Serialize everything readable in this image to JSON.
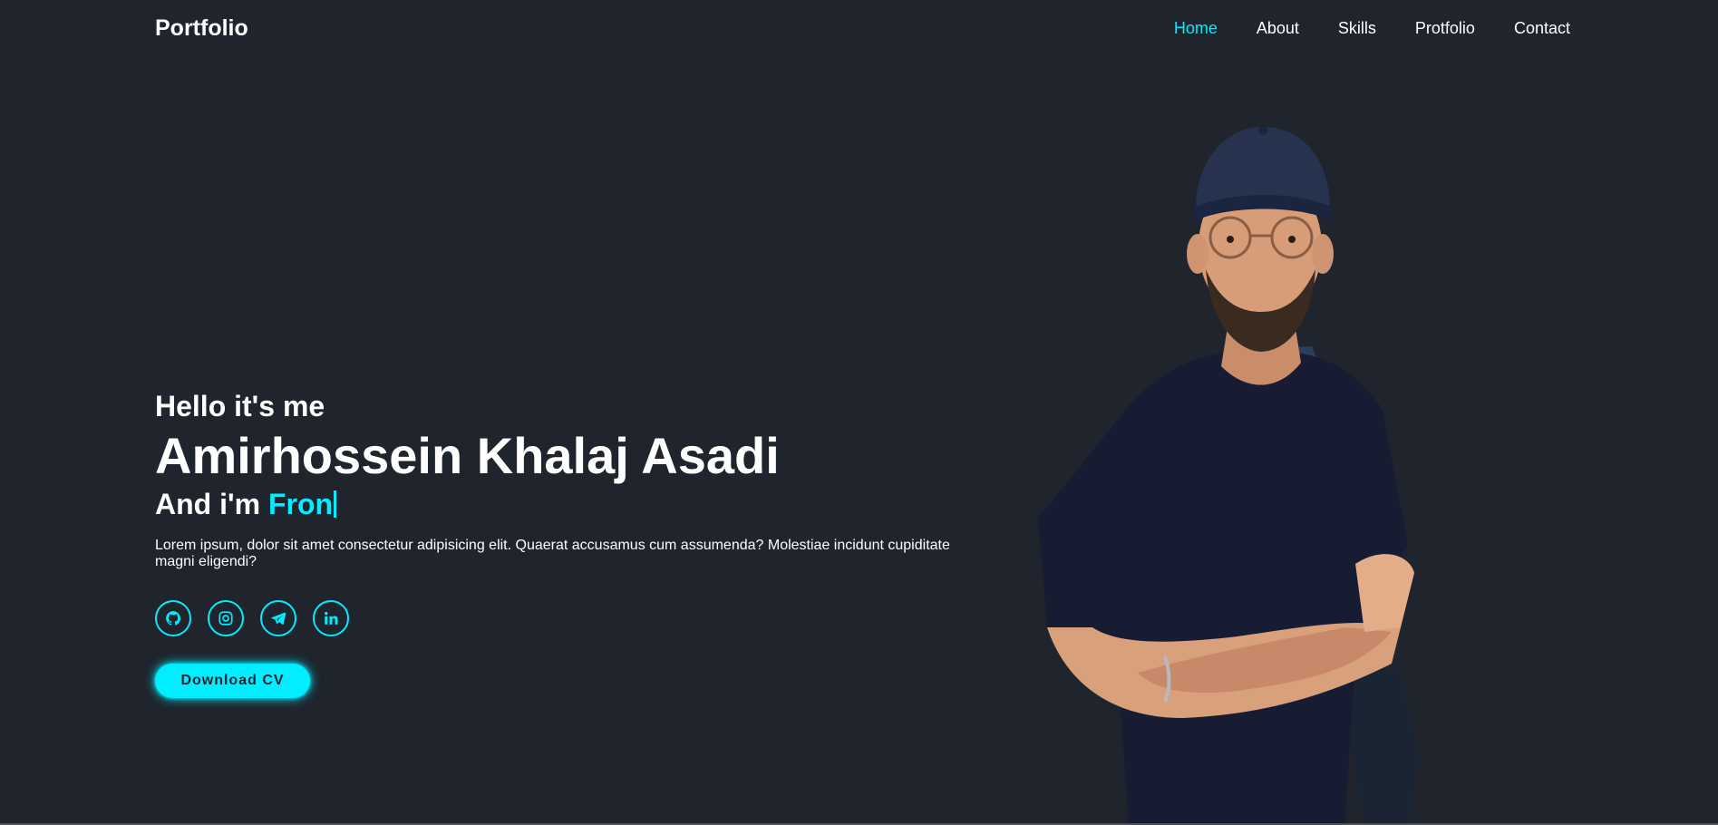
{
  "header": {
    "logo": "Portfolio",
    "nav": [
      {
        "label": "Home",
        "active": true
      },
      {
        "label": "About",
        "active": false
      },
      {
        "label": "Skills",
        "active": false
      },
      {
        "label": "Protfolio",
        "active": false
      },
      {
        "label": "Contact",
        "active": false
      }
    ]
  },
  "hero": {
    "greeting": "Hello it's me",
    "name": "Amirhossein Khalaj Asadi",
    "role_prefix": "And i'm",
    "role_typed": "Fron",
    "description": "Lorem ipsum, dolor sit amet consectetur adipisicing elit. Quaerat accusamus cum assumenda? Molestiae incidunt cupiditate magni eligendi?",
    "socials": [
      "github-icon",
      "instagram-icon",
      "telegram-icon",
      "linkedin-icon"
    ],
    "cta_label": "Download CV"
  },
  "colors": {
    "background": "#1f242d",
    "accent": "#00eeff",
    "text": "#ffffff"
  }
}
